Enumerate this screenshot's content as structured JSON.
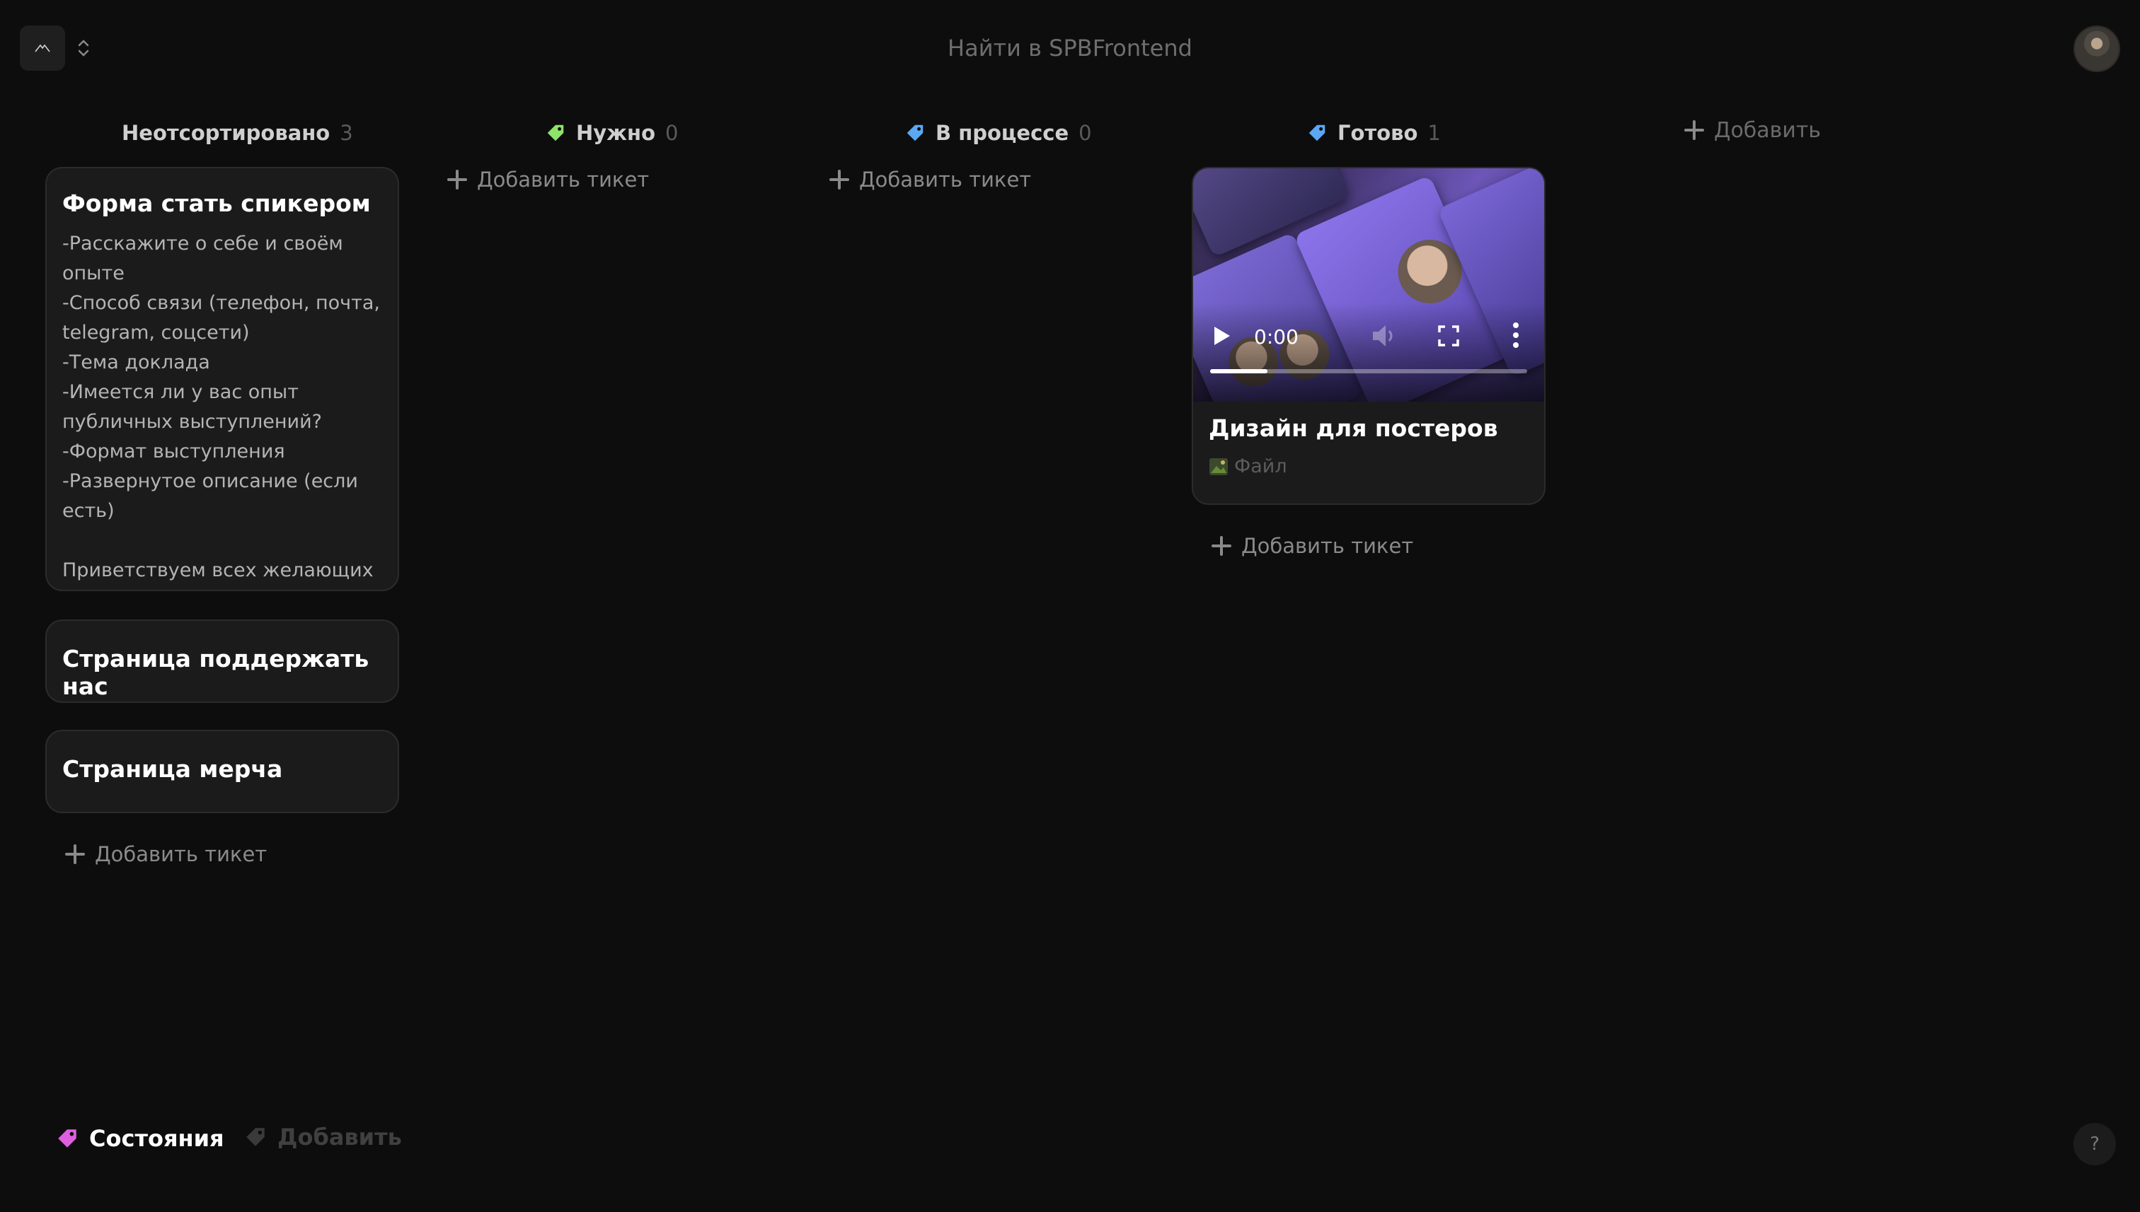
{
  "header": {
    "search_placeholder": "Найти в SPBFrontend"
  },
  "columns": [
    {
      "title": "Неотсортировано",
      "count": "3"
    },
    {
      "title": "Нужно",
      "count": "0",
      "tag_color": "#8fe36a"
    },
    {
      "title": "В процессе",
      "count": "0",
      "tag_color": "#5aa8f2"
    },
    {
      "title": "Готово",
      "count": "1",
      "tag_color": "#5aa8f2"
    }
  ],
  "add_column_label": "Добавить",
  "add_ticket_label": "Добавить тикет",
  "cards": {
    "unsorted": [
      {
        "title": "Форма стать спикером",
        "description": [
          "-Расскажите о себе и своём опыте",
          "-Способ связи (телефон, почта, telegram, соцсети)",
          "-Тема доклада",
          "-Имеется ли у вас опыт публичных выступлений?",
          "-Формат выступления",
          "-Развернутое описание (если есть)",
          "Приветствуем всех желающих"
        ]
      },
      {
        "title": "Страница поддержать нас"
      },
      {
        "title": "Страница мерча"
      }
    ],
    "done": [
      {
        "title": "Дизайн для постеров",
        "attachment_label": "Файл",
        "video": {
          "time": "0:00",
          "progress": 0.18
        }
      }
    ]
  },
  "footer": {
    "states_label": "Состояния",
    "states_tag_color": "#e05fe0",
    "add_label": "Добавить",
    "help_label": "?"
  },
  "icons": {
    "logo": "logo-icon",
    "switcher": "chevron-up-down-icon",
    "tag": "tag-icon",
    "plus": "plus-icon",
    "image": "image-icon",
    "play": "play-icon",
    "volume": "volume-icon",
    "fullscreen": "fullscreen-icon",
    "more": "more-vertical-icon"
  }
}
